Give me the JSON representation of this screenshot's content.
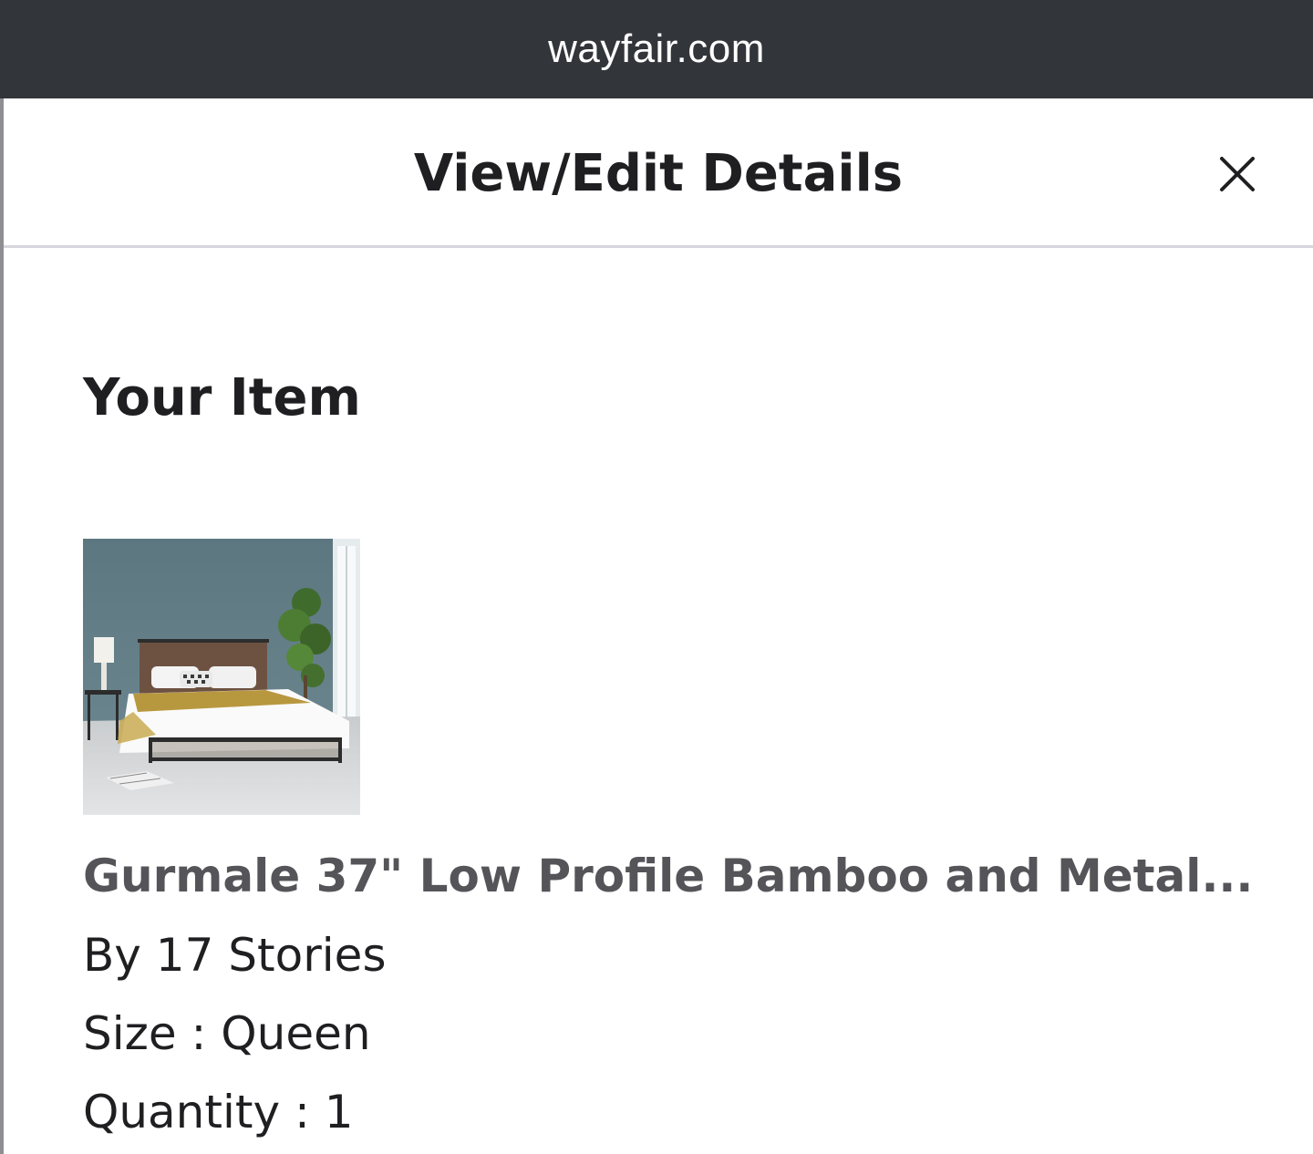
{
  "browser": {
    "url": "wayfair.com"
  },
  "modal": {
    "title": "View/Edit Details",
    "close_icon": "close-icon"
  },
  "item_section": {
    "heading": "Your Item",
    "name": "Gurmale 37\" Low Profile Bamboo and Metal...",
    "brand": "By 17 Stories",
    "size": "Size : Queen",
    "quantity": "Quantity : 1"
  },
  "colors": {
    "url_bar_bg": "#32353a",
    "text_primary": "#1f1f22",
    "text_secondary": "#555559",
    "divider": "#d6d6dc"
  }
}
